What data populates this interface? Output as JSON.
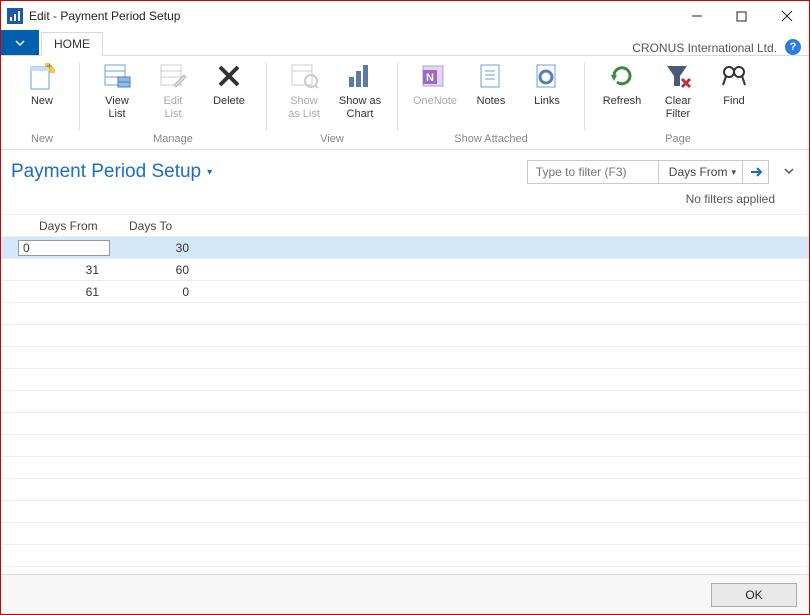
{
  "window": {
    "title": "Edit - Payment Period Setup"
  },
  "ribbonHeader": {
    "tab": "HOME",
    "company": "CRONUS International Ltd."
  },
  "ribbon": {
    "groups": {
      "new_grp": "New",
      "manage": "Manage",
      "view": "View",
      "show_attached": "Show Attached",
      "page": "Page"
    },
    "buttons": {
      "new": "New",
      "view_list": "View\nList",
      "edit_list": "Edit\nList",
      "delete": "Delete",
      "show_as_list": "Show\nas List",
      "show_as_chart": "Show as\nChart",
      "onenote": "OneNote",
      "notes": "Notes",
      "links": "Links",
      "refresh": "Refresh",
      "clear_filter": "Clear\nFilter",
      "find": "Find"
    }
  },
  "page": {
    "title": "Payment Period Setup",
    "filter_placeholder": "Type to filter (F3)",
    "filter_field": "Days From",
    "filter_status": "No filters applied"
  },
  "grid": {
    "columns": {
      "a": "Days From",
      "b": "Days To"
    },
    "rows": [
      {
        "days_from": "0",
        "days_to": "30",
        "selected": true,
        "editing": true
      },
      {
        "days_from": "31",
        "days_to": "60"
      },
      {
        "days_from": "61",
        "days_to": "0"
      }
    ]
  },
  "footer": {
    "ok": "OK"
  }
}
